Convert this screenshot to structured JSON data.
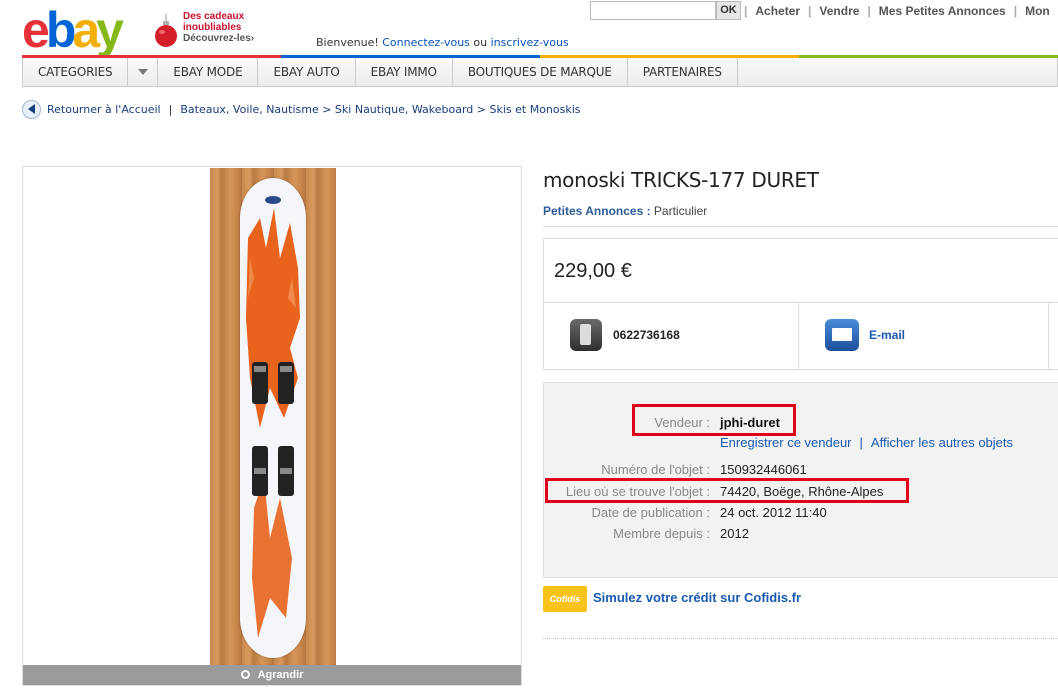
{
  "header": {
    "logo": {
      "e": "e",
      "b": "b",
      "a": "a",
      "y": "y"
    },
    "promo": {
      "line1": "Des cadeaux",
      "line2": "inoubliables",
      "line3": "Découvrez-les›"
    },
    "welcome": {
      "prefix": "Bienvenue!",
      "signin": "Connectez-vous",
      "or": "ou",
      "register": "inscrivez-vous"
    },
    "search": {
      "placeholder": "",
      "ok_label": "OK"
    },
    "links": [
      "Acheter",
      "Vendre",
      "Mes Petites Annonces",
      "Mon"
    ]
  },
  "nav": {
    "items": [
      "CATEGORIES",
      "EBAY MODE",
      "EBAY AUTO",
      "EBAY IMMO",
      "BOUTIQUES DE MARQUE",
      "PARTENAIRES"
    ]
  },
  "breadcrumb": {
    "back": "Retourner à l'Accueil",
    "separator": "|",
    "path": "Bateaux, Voile, Nautisme > Ski Nautique, Wakeboard > Skis et Monoskis"
  },
  "image": {
    "enlarge_label": "Agrandir"
  },
  "listing": {
    "title": "monoski TRICKS-177 DURET",
    "type_label": "Petites Annonces :",
    "type_value": "Particulier",
    "price": "229,00 €",
    "phone": "0622736168",
    "email_label": "E-mail"
  },
  "seller": {
    "vendor_label": "Vendeur :",
    "vendor_name": "jphi-duret",
    "save_seller": "Enregistrer ce vendeur",
    "links_sep": "|",
    "other_items": "Afficher les autres objets",
    "item_number_label": "Numéro de l'objet :",
    "item_number": "150932446061",
    "location_label": "Lieu où se trouve l'objet :",
    "location": "74420, Boëge, Rhône-Alpes",
    "pub_date_label": "Date de publication :",
    "pub_date": "24 oct. 2012 11:40",
    "member_since_label": "Membre depuis :",
    "member_since": "2012"
  },
  "cofidis": {
    "logo_text": "Cofidis",
    "link": "Simulez votre crédit sur Cofidis.fr"
  },
  "colors": {
    "highlight": "#e3001b",
    "link": "#1a5ab0"
  }
}
